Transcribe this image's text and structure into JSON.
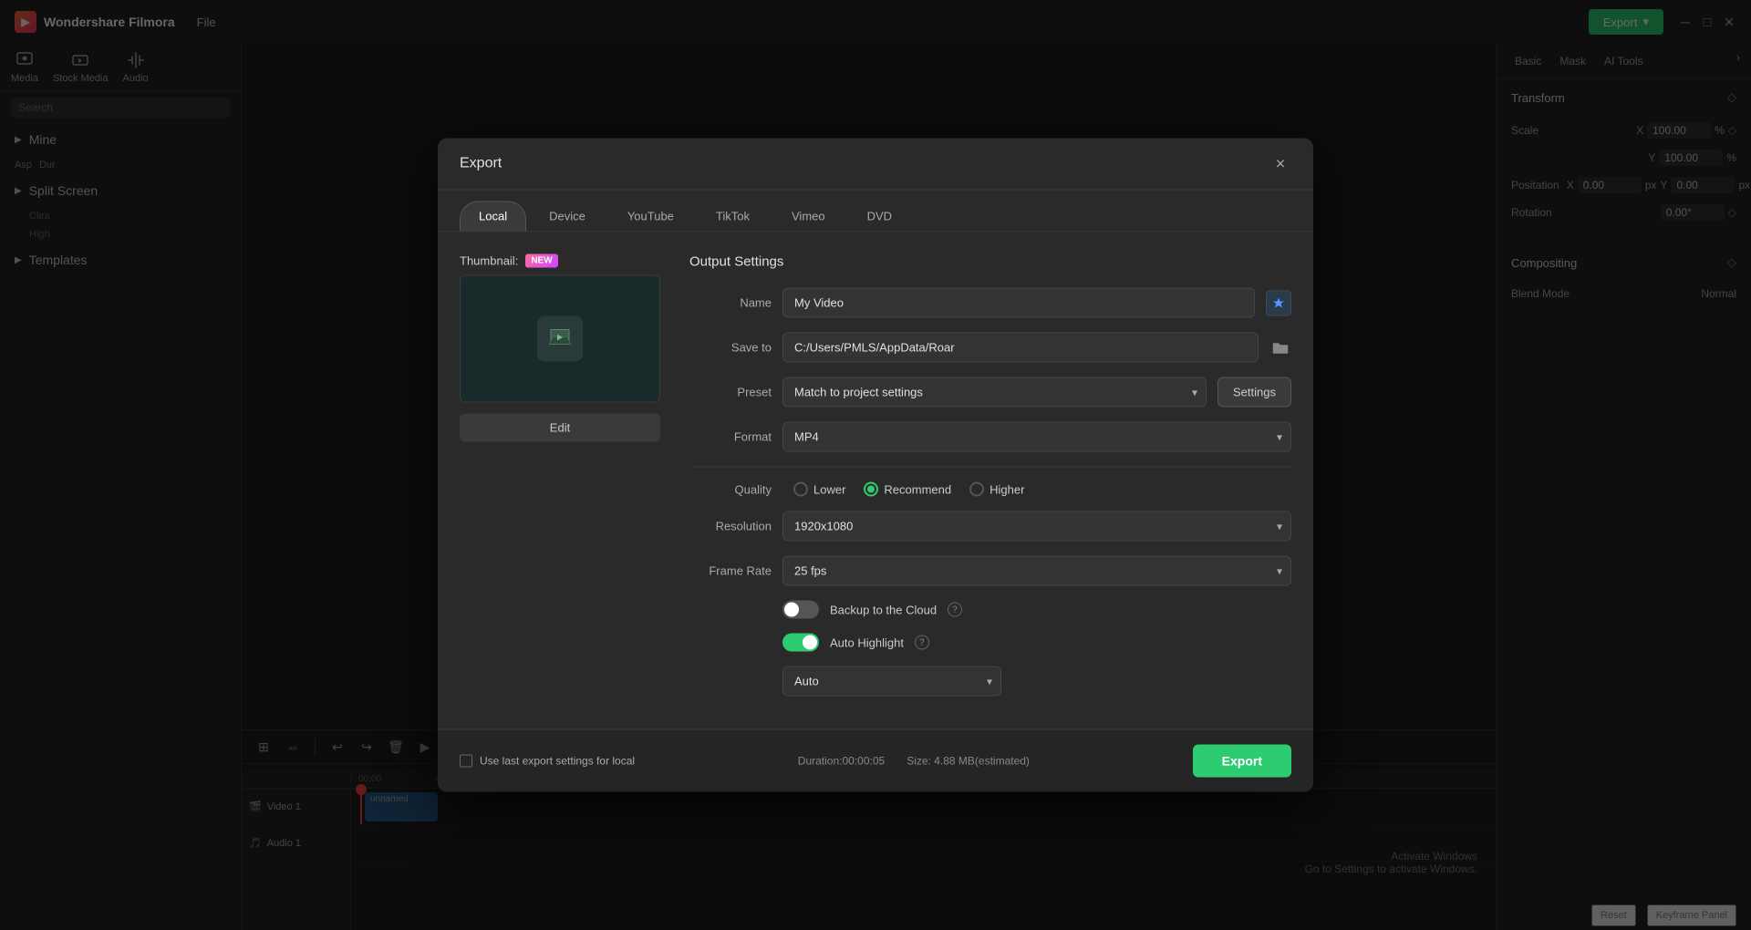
{
  "app": {
    "name": "Wondershare Filmora",
    "file_menu": "File"
  },
  "top_bar": {
    "export_label": "Export",
    "export_dropdown": "▾"
  },
  "left_panel": {
    "search_placeholder": "Search",
    "items": [
      {
        "id": "mine",
        "label": "Mine"
      },
      {
        "id": "split-screen",
        "label": "Split Screen"
      },
      {
        "id": "templates",
        "label": "Templates"
      }
    ],
    "aspect_label": "Asp",
    "duration_label": "Dur",
    "clear_label": "Clea",
    "high_label": "High"
  },
  "right_panel": {
    "tabs": [
      "Basic",
      "Mask",
      "AI Tools"
    ],
    "transform_label": "Transform",
    "x_label": "X",
    "y_label": "Y",
    "x_value": "100.00",
    "y_value": "100.00",
    "percent": "%",
    "rotation_label": "ation",
    "rx_value": "0.00",
    "ry_value": "0.00",
    "px_label": "px",
    "angle_value": "0.00°",
    "compositing_label": "Compositing",
    "blend_mode_label": "d Mode",
    "normal_label": "Normal",
    "keyframe_panel_label": "Keyframe Panel",
    "reset_label": "Reset"
  },
  "timeline": {
    "tracks": [
      {
        "id": "video1",
        "label": "Video 1"
      },
      {
        "id": "audio1",
        "label": "Audio 1"
      }
    ],
    "time_markers": [
      "00:00",
      "00:00"
    ],
    "clip_name": "unnamed"
  },
  "modal": {
    "title": "Export",
    "close_icon": "×",
    "tabs": [
      {
        "id": "local",
        "label": "Local",
        "active": true
      },
      {
        "id": "device",
        "label": "Device"
      },
      {
        "id": "youtube",
        "label": "YouTube"
      },
      {
        "id": "tiktok",
        "label": "TikTok"
      },
      {
        "id": "vimeo",
        "label": "Vimeo"
      },
      {
        "id": "dvd",
        "label": "DVD"
      }
    ],
    "thumbnail": {
      "label": "Thumbnail:",
      "new_badge": "NEW",
      "edit_btn": "Edit"
    },
    "output": {
      "title": "Output Settings",
      "name_label": "Name",
      "name_value": "My Video",
      "save_to_label": "Save to",
      "save_to_value": "C:/Users/PMLS/AppData/Roar",
      "preset_label": "Preset",
      "preset_value": "Match to project settings",
      "settings_btn": "Settings",
      "format_label": "Format",
      "format_value": "MP4",
      "quality_label": "Quality",
      "quality_options": [
        {
          "id": "lower",
          "label": "Lower",
          "checked": false
        },
        {
          "id": "recommend",
          "label": "Recommend",
          "checked": true
        },
        {
          "id": "higher",
          "label": "Higher",
          "checked": false
        }
      ],
      "resolution_label": "Resolution",
      "resolution_value": "1920x1080",
      "frame_rate_label": "Frame Rate",
      "frame_rate_value": "25 fps",
      "backup_cloud_label": "Backup to the Cloud",
      "backup_cloud_on": false,
      "auto_highlight_label": "Auto Highlight",
      "auto_highlight_on": true,
      "highlight_mode_value": "Auto"
    },
    "footer": {
      "checkbox_label": "Use last export settings for local",
      "duration_label": "Duration:00:00:05",
      "size_label": "Size: 4.88 MB(estimated)",
      "export_btn": "Export"
    }
  },
  "watermark": {
    "line1": "Activate Windows",
    "line2": "Go to Settings to activate Windows."
  }
}
